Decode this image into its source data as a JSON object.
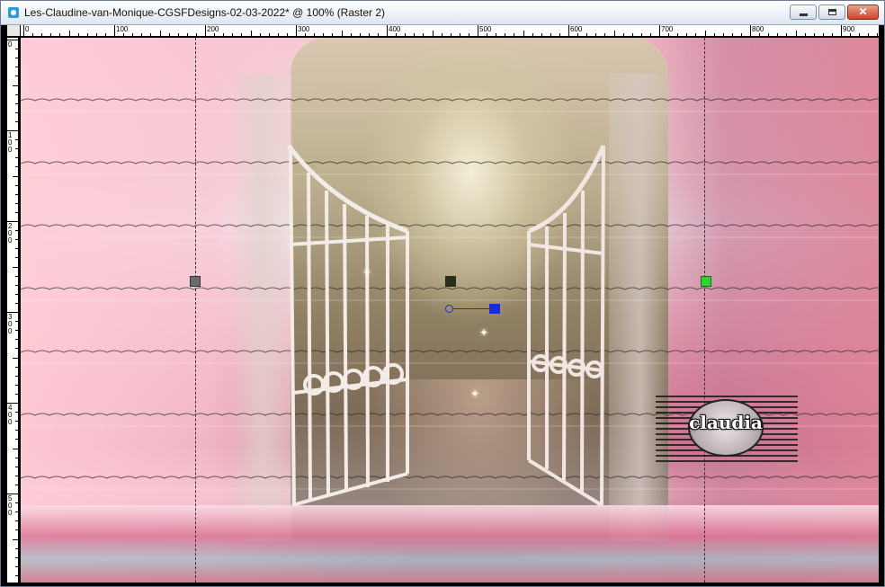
{
  "window": {
    "title": "Les-Claudine-van-Monique-CGSFDesigns-02-03-2022* @ 100% (Raster 2)",
    "icon": "app-document-icon",
    "controls": {
      "minimize": "minimize-icon",
      "maximize": "maximize-icon",
      "close": "close-icon",
      "close_glyph": "✕"
    }
  },
  "rulers": {
    "top_labels": [
      "0",
      "100",
      "200",
      "300",
      "400",
      "500",
      "600",
      "700",
      "800",
      "900"
    ],
    "left_labels": [
      "0",
      "1\n0\n0",
      "2\n0\n0",
      "3\n0\n0",
      "4\n0\n0",
      "5\n0\n0"
    ]
  },
  "image": {
    "description_layers": [
      "background",
      "forest-gate",
      "floor"
    ],
    "watermark_text": "claudia",
    "selected_layer": "Raster 2",
    "zoom": "100%"
  },
  "colors": {
    "handle_left": "#6a6a72",
    "handle_right": "#2fd52f",
    "handle_center": "#2b2b1e",
    "rotation_handle": "#1b2bd8"
  }
}
